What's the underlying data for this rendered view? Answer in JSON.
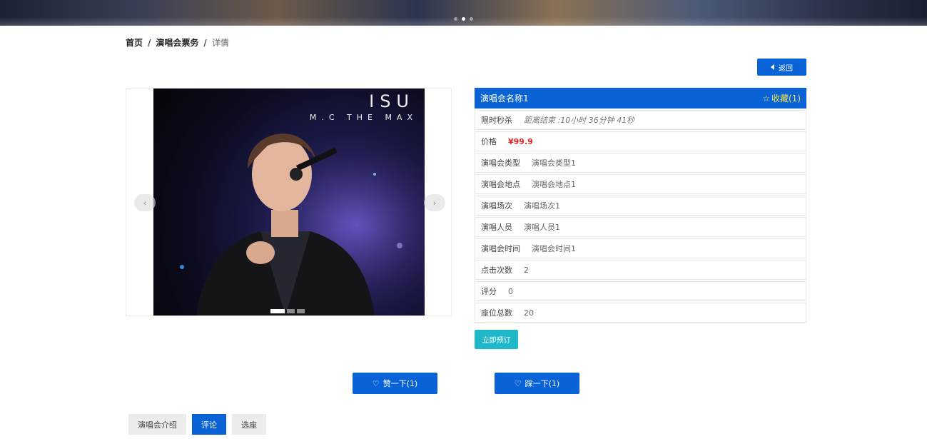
{
  "breadcrumb": {
    "home": "首页",
    "sep1": "/",
    "section": "演唱会票务",
    "sep2": "/",
    "current": "详情"
  },
  "back_button": {
    "label": "返回",
    "icon": "caret-left-icon"
  },
  "carousel": {
    "image_title": "ISU",
    "image_subtitle": "M.C THE MAX",
    "prev_icon": "chevron-left-icon",
    "next_icon": "chevron-right-icon",
    "slide_count": 3,
    "active_slide": 1
  },
  "concert": {
    "name": "演唱会名称1",
    "favorite_label": "收藏(1)",
    "rows": [
      {
        "label": "限时秒杀",
        "value": "距离结束 :10小时 36分钟 41秒"
      },
      {
        "label": "价格",
        "value": "¥99.9"
      },
      {
        "label": "演唱会类型",
        "value": "演唱会类型1"
      },
      {
        "label": "演唱会地点",
        "value": "演唱会地点1"
      },
      {
        "label": "演唱场次",
        "value": "演唱场次1"
      },
      {
        "label": "演唱人员",
        "value": "演唱人员1"
      },
      {
        "label": "演唱会时间",
        "value": "演唱会时间1"
      },
      {
        "label": "点击次数",
        "value": "2"
      },
      {
        "label": "评分",
        "value": "0"
      },
      {
        "label": "座位总数",
        "value": "20"
      }
    ],
    "book_label": "立即预订"
  },
  "votes": {
    "like_label": "赞一下(1)",
    "dislike_label": "踩一下(1)"
  },
  "tabs": [
    {
      "label": "演唱会介绍",
      "active": false
    },
    {
      "label": "评论",
      "active": true
    },
    {
      "label": "选座",
      "active": false
    }
  ],
  "colors": {
    "primary": "#0a63d6",
    "book": "#1fb8c8",
    "price": "#e02a2a",
    "favorite": "#f3e44a"
  }
}
